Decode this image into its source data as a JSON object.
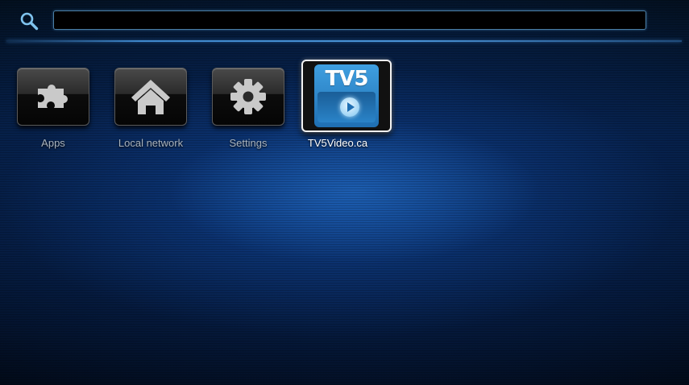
{
  "search": {
    "value": "",
    "placeholder": ""
  },
  "tiles": [
    {
      "label": "Apps",
      "icon": "puzzle-icon",
      "selected": false
    },
    {
      "label": "Local network",
      "icon": "house-icon",
      "selected": false
    },
    {
      "label": "Settings",
      "icon": "gear-icon",
      "selected": false
    },
    {
      "label": "TV5Video.ca",
      "icon": "tv5-logo",
      "selected": true,
      "logo_text": "TV5"
    }
  ],
  "colors": {
    "accent": "#3f88cc",
    "background": "#051a3a",
    "label_inactive": "#a9b3bd",
    "label_active": "#ffffff"
  }
}
